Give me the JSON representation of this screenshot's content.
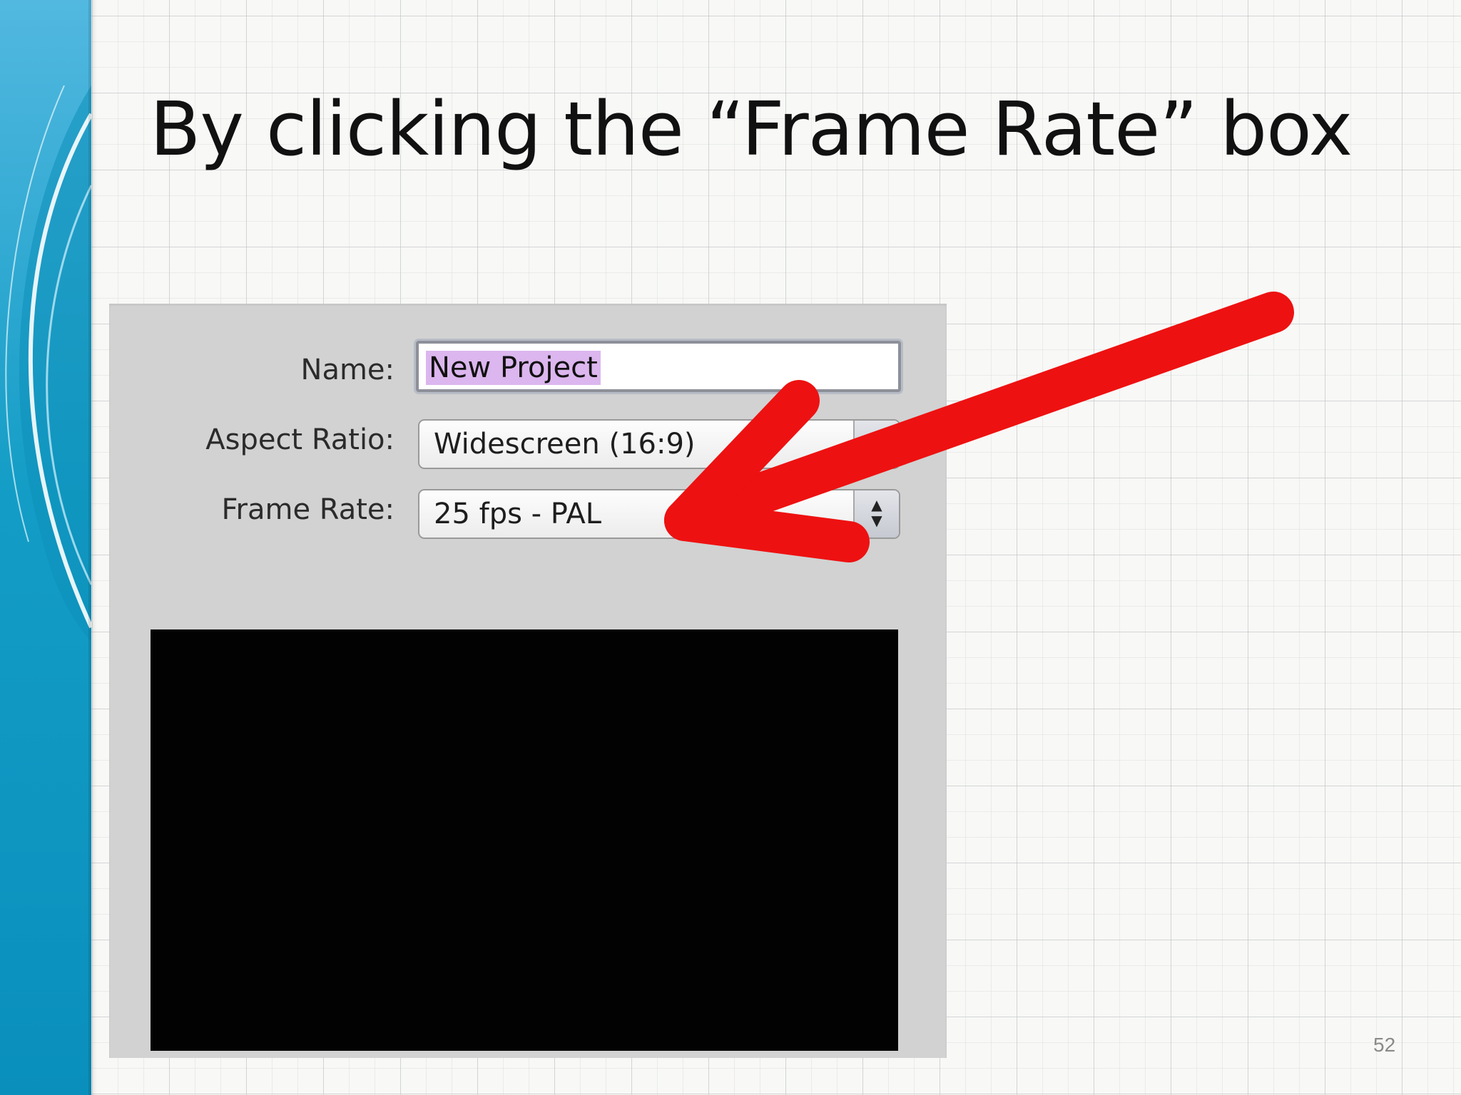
{
  "slide": {
    "title": "By clicking the “Frame Rate” box",
    "page_number": "52"
  },
  "dialog": {
    "name": {
      "label": "Name:",
      "value": "New Project"
    },
    "aspect_ratio": {
      "label": "Aspect Ratio:",
      "value": "Widescreen (16:9)"
    },
    "frame_rate": {
      "label": "Frame Rate:",
      "value": "25 fps - PAL"
    },
    "selection_highlight_color": "#dcb6ee",
    "preview_color": "#030203"
  },
  "annotation": {
    "arrow_color": "#ee1111",
    "points_to": "frame_rate"
  },
  "icons": {
    "stepper": "up-down-arrows-icon"
  },
  "theme": {
    "band_color": "#1aa3c8",
    "grid_color": "#bec3c3"
  }
}
